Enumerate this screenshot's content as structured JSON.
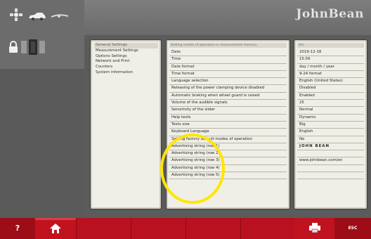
{
  "brand": "JohnBean",
  "menu": {
    "items": [
      "General Settings",
      "Measurement Settings",
      "Options Settings",
      "Network and Print",
      "Counters",
      "System information"
    ]
  },
  "table": {
    "headers": [
      "Setting modes of operation in measurement memory",
      "Val"
    ],
    "rows": [
      {
        "label": "Date",
        "value": "2019-12-18"
      },
      {
        "label": "Time",
        "value": "15:56"
      },
      {
        "label": "Date format",
        "value": "day / month / year"
      },
      {
        "label": "Time format",
        "value": "9-24 format"
      },
      {
        "label": "Language selection",
        "value": "English (United States)"
      },
      {
        "label": "Releasing of the power clamping device disabled",
        "value": "Disabled"
      },
      {
        "label": "Automatic braking when wheel guard is raised",
        "value": "Enabled"
      },
      {
        "label": "Volume of the audible signals",
        "value": "25"
      },
      {
        "label": "Sensitivity of the slider",
        "value": "Normal"
      },
      {
        "label": "Help texts",
        "value": "Dynamic"
      },
      {
        "label": "Texts size",
        "value": "Big"
      },
      {
        "label": "Keyboard Language",
        "value": "English"
      },
      {
        "label": "Setting factory default modes of operation",
        "value": "No"
      },
      {
        "label": "Advertising string (row 1)",
        "value": "JOHN BEAN"
      },
      {
        "label": "Advertising string (row 2)",
        "value": ""
      },
      {
        "label": "Advertising string (row 3)",
        "value": "www.johnbean.com/en"
      },
      {
        "label": "Advertising string (row 4)",
        "value": ""
      },
      {
        "label": "Advertising string (row 5)",
        "value": ""
      }
    ]
  },
  "bottombar": {
    "help": "?",
    "esc": "ESC"
  },
  "colors": {
    "bar_red": "#b30f1c",
    "panel_bg": "#f0efe7",
    "annotation": "#ffe600"
  },
  "icons": [
    "balancer-icon",
    "car-icon",
    "wheel-icon",
    "lock-icon",
    "weight-icon",
    "home-icon",
    "printer-icon"
  ]
}
